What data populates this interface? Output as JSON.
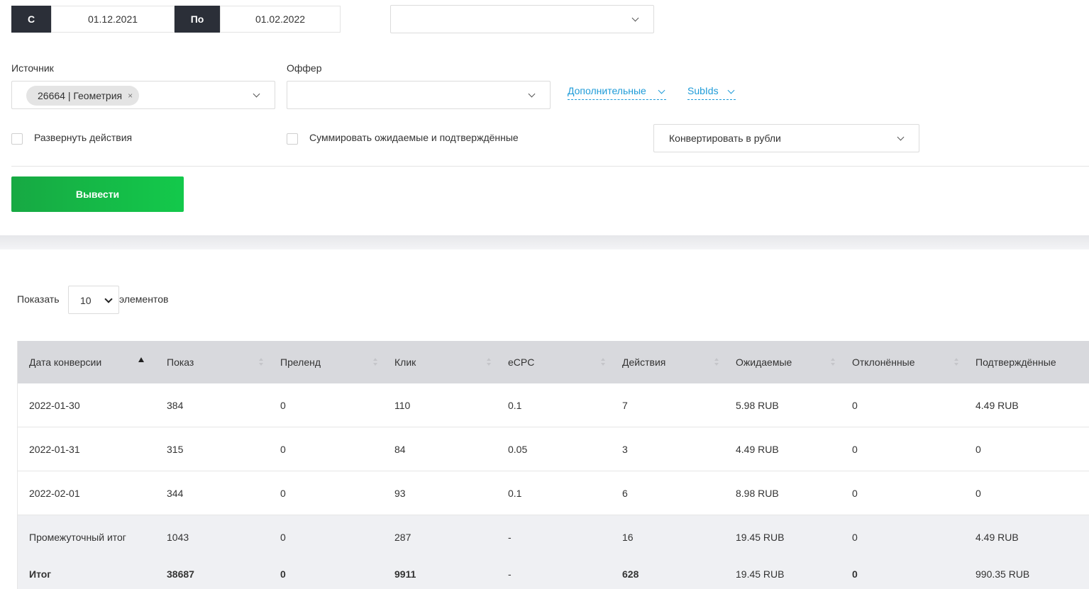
{
  "filters": {
    "date_from_label": "С",
    "date_from": "01.12.2021",
    "date_to_label": "По",
    "date_to": "01.02.2022",
    "top_select_value": "",
    "source_label": "Источник",
    "source_tag": "26664 | Геометрия",
    "source_tag_remove": "×",
    "offer_label": "Оффер",
    "offer_value": "",
    "extra_dropdown": "Дополнительные",
    "subids_dropdown": "SubIds",
    "expand_actions_label": "Развернуть действия",
    "sum_label": "Суммировать ожидаемые и подтверждённые",
    "convert_value": "Конвертировать в рубли",
    "submit_label": "Вывести"
  },
  "page_size": {
    "prefix": "Показать",
    "value": "10",
    "suffix": "элементов"
  },
  "table": {
    "headers": [
      "Дата конверсии",
      "Показ",
      "Преленд",
      "Клик",
      "eCPC",
      "Действия",
      "Ожидаемые",
      "Отклонённые",
      "Подтверждённые"
    ],
    "rows": [
      [
        "2022-01-30",
        "384",
        "0",
        "110",
        "0.1",
        "7",
        "5.98 RUB",
        "0",
        "4.49 RUB"
      ],
      [
        "2022-01-31",
        "315",
        "0",
        "84",
        "0.05",
        "3",
        "4.49 RUB",
        "0",
        "0"
      ],
      [
        "2022-02-01",
        "344",
        "0",
        "93",
        "0.1",
        "6",
        "8.98 RUB",
        "0",
        "0"
      ]
    ],
    "subtotal": [
      "Промежуточный итог",
      "1043",
      "0",
      "287",
      "-",
      "16",
      "19.45 RUB",
      "0",
      "4.49 RUB"
    ],
    "total": [
      "Итог",
      "38687",
      "0",
      "9911",
      "-",
      "628",
      "19.45 RUB",
      "0",
      "990.35 RUB"
    ]
  }
}
